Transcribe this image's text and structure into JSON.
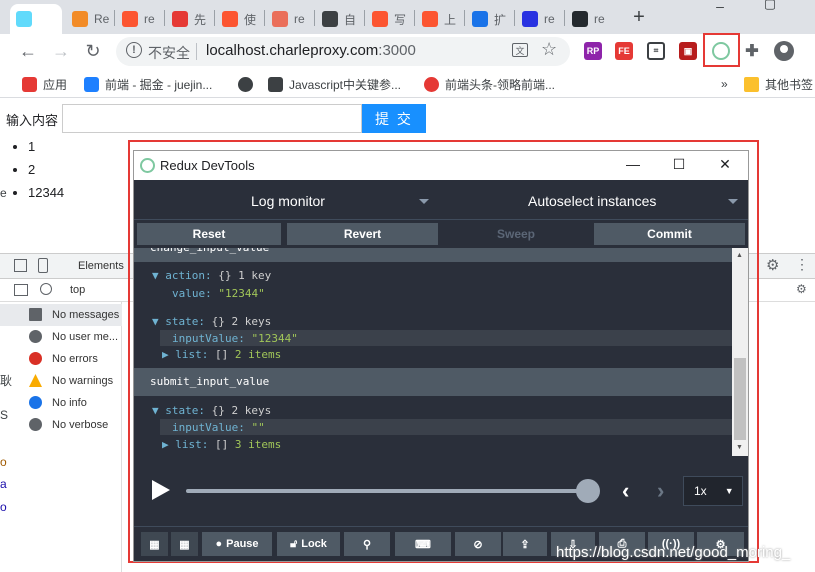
{
  "tabs": [
    {
      "label": "",
      "icon": "react-icon",
      "color": "#61dafb",
      "active": true
    },
    {
      "label": "Re",
      "icon": "puzzle-icon",
      "color": "#f28b27"
    },
    {
      "label": "re",
      "icon": "csdn-icon",
      "color": "#fc5531"
    },
    {
      "label": "先",
      "icon": "flame-icon",
      "color": "#e53935"
    },
    {
      "label": "使",
      "icon": "csdn-icon",
      "color": "#fc5531"
    },
    {
      "label": "re",
      "icon": "jianshu-icon",
      "color": "#ea6f5a"
    },
    {
      "label": "自",
      "icon": "book-icon",
      "color": "#3c4043"
    },
    {
      "label": "写",
      "icon": "csdn-icon",
      "color": "#fc5531"
    },
    {
      "label": "上",
      "icon": "csdn-icon",
      "color": "#fc5531"
    },
    {
      "label": "扩",
      "icon": "extension-icon",
      "color": "#1a73e8"
    },
    {
      "label": "re",
      "icon": "baidu-icon",
      "color": "#2932e1"
    },
    {
      "label": "re",
      "icon": "github-icon",
      "color": "#24292e"
    }
  ],
  "omnibox": {
    "security": "不安全",
    "host": "localhost.charleproxy.com",
    "port": ":3000"
  },
  "bookmarks": [
    {
      "label": "应用",
      "icon": "apps-icon",
      "color": "#e53935"
    },
    {
      "label": "前端 - 掘金 - juejin...",
      "icon": "juejin-icon",
      "color": "#1e80ff"
    },
    {
      "label": "",
      "icon": "globe-icon",
      "color": "#3c4043"
    },
    {
      "label": "Javascript中关键参...",
      "icon": "js-icon",
      "color": "#3c4043"
    },
    {
      "label": "前端头条-领略前端...",
      "icon": "html-icon",
      "color": "#e53935"
    }
  ],
  "bookmarks_more": "»",
  "other_bookmarks": "其他书签",
  "page": {
    "label": "输入内容",
    "input_value": "",
    "submit": "提 交",
    "items": [
      "1",
      "2",
      "12344"
    ]
  },
  "devtools": {
    "tab": "Elements",
    "context": "top",
    "sidebar": [
      {
        "label": "No messages",
        "icon": "list-icon",
        "color": "#5f6368"
      },
      {
        "label": "No user me...",
        "icon": "user-icon",
        "color": "#5f6368"
      },
      {
        "label": "No errors",
        "icon": "error-icon",
        "color": "#d93025"
      },
      {
        "label": "No warnings",
        "icon": "warning-icon",
        "color": "#f9ab00"
      },
      {
        "label": "No info",
        "icon": "info-icon",
        "color": "#1a73e8"
      },
      {
        "label": "No verbose",
        "icon": "bug-icon",
        "color": "#5f6368"
      }
    ]
  },
  "redux": {
    "title": "Redux DevTools",
    "monitor": "Log monitor",
    "instances": "Autoselect instances",
    "buttons": {
      "reset": "Reset",
      "revert": "Revert",
      "sweep": "Sweep",
      "commit": "Commit"
    },
    "log": {
      "action1": "change_input_value",
      "action_key": "action:",
      "obj": "{}",
      "one_key": "1 key",
      "value_key": "value:",
      "value_val": "\"12344\"",
      "state_key": "state:",
      "two_keys": "2 keys",
      "input_key": "inputValue:",
      "input_val1": "\"12344\"",
      "list_key": "list:",
      "arr": "[]",
      "items2": "2 items",
      "action2": "submit_input_value",
      "input_val2": "\"\"",
      "items3": "3 items"
    },
    "speed": "1x",
    "footer": {
      "pause": "Pause",
      "lock": "Lock"
    },
    "playback_position": 1.0
  },
  "watermark": "https://blog.csdn.net/good_moring_"
}
